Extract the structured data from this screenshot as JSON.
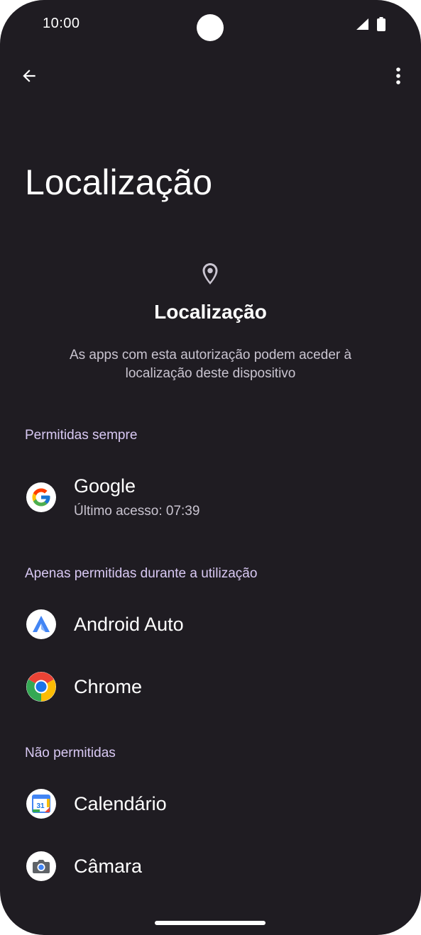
{
  "status_bar": {
    "time": "10:00"
  },
  "page": {
    "title": "Localização",
    "header_title": "Localização",
    "description": "As apps com esta autorização podem aceder à localização deste dispositivo"
  },
  "sections": [
    {
      "title": "Permitidas sempre",
      "apps": [
        {
          "name": "Google",
          "subtitle": "Último acesso: 07:39",
          "icon": "google-icon"
        }
      ]
    },
    {
      "title": "Apenas permitidas durante a utilização",
      "apps": [
        {
          "name": "Android Auto",
          "icon": "android-auto-icon"
        },
        {
          "name": "Chrome",
          "icon": "chrome-icon"
        }
      ]
    },
    {
      "title": "Não permitidas",
      "apps": [
        {
          "name": "Calendário",
          "icon": "calendar-icon",
          "icon_text": "31"
        },
        {
          "name": "Câmara",
          "icon": "camera-icon"
        }
      ]
    }
  ],
  "colors": {
    "background": "#1f1c22",
    "section_header": "#d9c9f4",
    "text": "#ffffff",
    "secondary_text": "#c9c4d0"
  }
}
